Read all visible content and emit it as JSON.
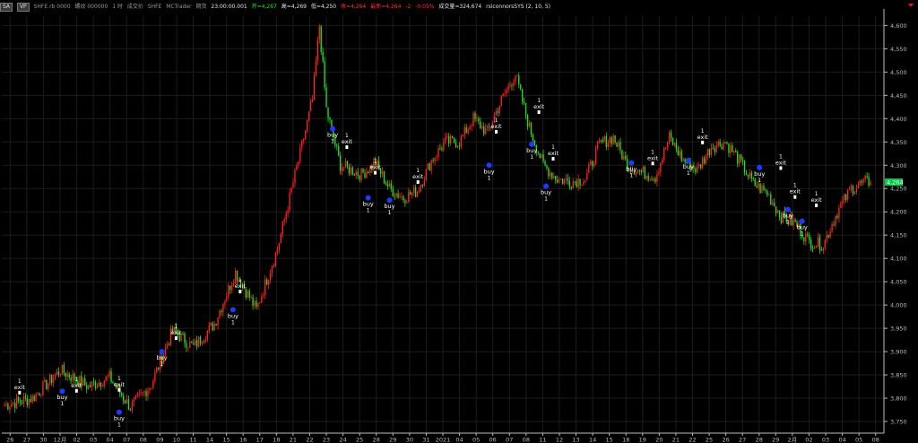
{
  "toolbar": {
    "btn_a": "SA",
    "btn_b": "VP",
    "symbol": "SHFE.rb 0000",
    "name": "螺纹 000000",
    "interval": "1 时",
    "data_type": "成交价",
    "exchange": "SHFE",
    "source": "MCTrader",
    "period_label": "期货",
    "time": "23:00:00.001",
    "open": "开=4,267",
    "high": "高=4,269",
    "low": "低=4,250",
    "close": "收=4,264",
    "last": "最新=4,264",
    "change": "-2",
    "pct": "-0.05%",
    "volume": "成交量=324,674",
    "strategy": "rsiconnorsSYS (2, 10, 5)"
  },
  "chart_data": {
    "type": "candlestick",
    "y_ticks": [
      3750,
      3800,
      3850,
      3900,
      3950,
      4000,
      4050,
      4100,
      4150,
      4200,
      4250,
      4300,
      4350,
      4400,
      4450,
      4500,
      4550,
      4600
    ],
    "ylim": [
      3725,
      4620
    ],
    "last_price": "4,264",
    "last_price_value": 4264,
    "x_labels": [
      "26",
      "27",
      "30",
      "12月",
      "02",
      "03",
      "04",
      "07",
      "08",
      "09",
      "10",
      "11",
      "14",
      "15",
      "16",
      "17",
      "18",
      "21",
      "22",
      "23",
      "24",
      "25",
      "28",
      "29",
      "30",
      "31",
      "2021",
      "04",
      "05",
      "06",
      "07",
      "08",
      "11",
      "12",
      "13",
      "14",
      "15",
      "18",
      "19",
      "20",
      "21",
      "22",
      "25",
      "26",
      "27",
      "28",
      "29",
      "2月",
      "02",
      "03",
      "04",
      "05",
      "08"
    ],
    "close_path": [
      [
        0,
        3785
      ],
      [
        4,
        3800
      ],
      [
        8,
        3860
      ],
      [
        12,
        3825
      ],
      [
        15,
        3845
      ],
      [
        18,
        3780
      ],
      [
        21,
        3830
      ],
      [
        24,
        3945
      ],
      [
        27,
        3910
      ],
      [
        30,
        3960
      ],
      [
        33,
        4070
      ],
      [
        36,
        3990
      ],
      [
        39,
        4120
      ],
      [
        42,
        4310
      ],
      [
        44,
        4440
      ],
      [
        45,
        4600
      ],
      [
        46,
        4420
      ],
      [
        48,
        4300
      ],
      [
        51,
        4280
      ],
      [
        53,
        4305
      ],
      [
        55,
        4250
      ],
      [
        57,
        4230
      ],
      [
        59,
        4245
      ],
      [
        61,
        4310
      ],
      [
        63,
        4350
      ],
      [
        65,
        4350
      ],
      [
        67,
        4400
      ],
      [
        69,
        4370
      ],
      [
        71,
        4440
      ],
      [
        73,
        4495
      ],
      [
        75,
        4380
      ],
      [
        77,
        4300
      ],
      [
        79,
        4270
      ],
      [
        81,
        4265
      ],
      [
        83,
        4270
      ],
      [
        85,
        4345
      ],
      [
        87,
        4360
      ],
      [
        89,
        4300
      ],
      [
        91,
        4285
      ],
      [
        93,
        4275
      ],
      [
        95,
        4360
      ],
      [
        97,
        4310
      ],
      [
        99,
        4290
      ],
      [
        101,
        4340
      ],
      [
        103,
        4350
      ],
      [
        105,
        4310
      ],
      [
        107,
        4260
      ],
      [
        109,
        4240
      ],
      [
        111,
        4190
      ],
      [
        113,
        4175
      ],
      [
        115,
        4135
      ],
      [
        117,
        4130
      ],
      [
        119,
        4200
      ],
      [
        121,
        4250
      ],
      [
        123,
        4264
      ]
    ],
    "signals": [
      {
        "label": "exit",
        "qty": "1",
        "i": 2,
        "price": 3808
      },
      {
        "label": "buy",
        "qty": "1",
        "i": 8,
        "price": 3815
      },
      {
        "label": "exit",
        "qty": "1",
        "i": 10,
        "price": 3812
      },
      {
        "label": "exit",
        "qty": "1",
        "i": 16,
        "price": 3814
      },
      {
        "label": "buy",
        "qty": "1",
        "i": 16,
        "price": 3770
      },
      {
        "label": "buy",
        "qty": "1",
        "i": 22,
        "price": 3900
      },
      {
        "label": "exit",
        "qty": "1",
        "i": 24,
        "price": 3925
      },
      {
        "label": "buy",
        "qty": "1",
        "i": 32,
        "price": 3990
      },
      {
        "label": "exit",
        "qty": "1",
        "i": 33,
        "price": 4025
      },
      {
        "label": "buy",
        "qty": "1",
        "i": 46,
        "price": 4378
      },
      {
        "label": "exit",
        "qty": "1",
        "i": 48,
        "price": 4335
      },
      {
        "label": "buy",
        "qty": "1",
        "i": 51,
        "price": 4230
      },
      {
        "label": "exit",
        "qty": "1",
        "i": 52,
        "price": 4280
      },
      {
        "label": "buy",
        "qty": "1",
        "i": 54,
        "price": 4225
      },
      {
        "label": "exit",
        "qty": "1",
        "i": 58,
        "price": 4260
      },
      {
        "label": "buy",
        "qty": "1",
        "i": 68,
        "price": 4300
      },
      {
        "label": "exit",
        "qty": "1",
        "i": 69,
        "price": 4368
      },
      {
        "label": "buy",
        "qty": "1",
        "i": 74,
        "price": 4345
      },
      {
        "label": "exit",
        "qty": "1",
        "i": 75,
        "price": 4410
      },
      {
        "label": "buy",
        "qty": "1",
        "i": 76,
        "price": 4255
      },
      {
        "label": "exit",
        "qty": "1",
        "i": 77,
        "price": 4310
      },
      {
        "label": "buy",
        "qty": "1",
        "i": 88,
        "price": 4305
      },
      {
        "label": "exit",
        "qty": "1",
        "i": 91,
        "price": 4300
      },
      {
        "label": "buy",
        "qty": "1",
        "i": 96,
        "price": 4310
      },
      {
        "label": "exit",
        "qty": "1",
        "i": 98,
        "price": 4345
      },
      {
        "label": "buy",
        "qty": "1",
        "i": 106,
        "price": 4295
      },
      {
        "label": "exit",
        "qty": "1",
        "i": 109,
        "price": 4290
      },
      {
        "label": "exit",
        "qty": "1",
        "i": 111,
        "price": 4228
      },
      {
        "label": "buy",
        "qty": "1",
        "i": 110,
        "price": 4205
      },
      {
        "label": "buy",
        "qty": "1",
        "i": 112,
        "price": 4180
      },
      {
        "label": "exit",
        "qty": "1",
        "i": 114,
        "price": 4210
      }
    ],
    "colors": {
      "up": "#ff2020",
      "down": "#22dd22",
      "grid": "#1c1c1c",
      "axis": "#bbbbbb",
      "buy": "#1a3cff",
      "exit": "#ffffff",
      "last_bg": "#00cc44"
    }
  }
}
